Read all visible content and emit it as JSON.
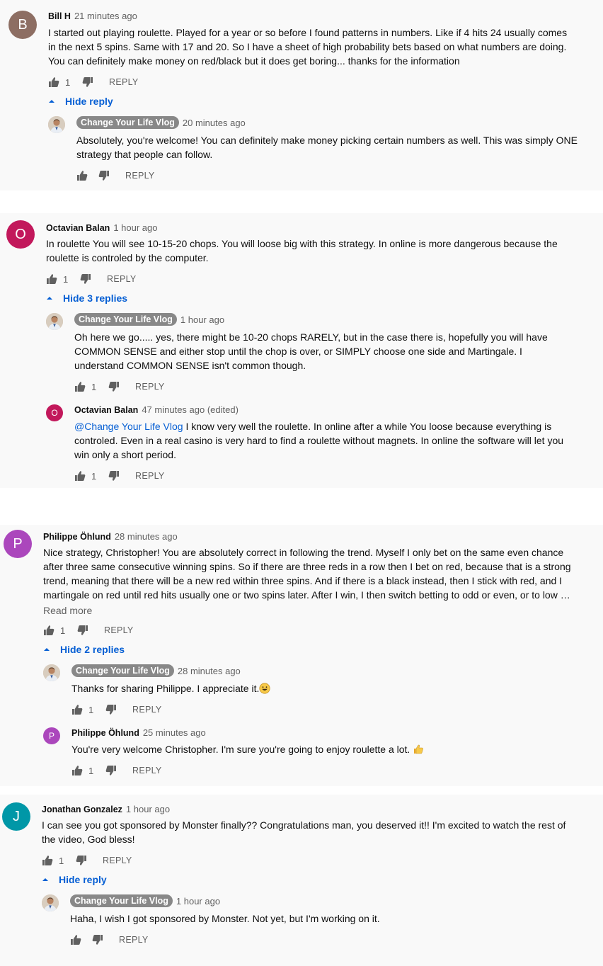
{
  "reply_label": "REPLY",
  "threads": [
    {
      "author": "Bill H",
      "initial": "B",
      "avatar_color": "#8d6e63",
      "time": "21 minutes ago",
      "text": "I started out playing roulette. Played for a year or so before I found patterns in numbers. Like if 4 hits 24 usually comes in the next 5 spins. Same with 17 and 20. So I have a sheet of high probability bets based on what numbers are doing. You can definitely make money on red/black but it does get boring... thanks for the information",
      "likes": "1",
      "toggle": "Hide reply",
      "replies": [
        {
          "author": "Change Your Life Vlog",
          "time": "20 minutes ago",
          "text": "Absolutely, you're welcome! You can definitely make money picking certain numbers as well. This was simply ONE strategy that people can follow.",
          "likes": ""
        }
      ]
    },
    {
      "author": "Octavian Balan",
      "initial": "O",
      "avatar_color": "#c2185b",
      "time": "1 hour ago",
      "text": "In roulette You will see 10-15-20 chops. You will loose big with this strategy. In online is more dangerous because  the roulette is controled by the computer.",
      "likes": "1",
      "toggle": "Hide 3 replies",
      "replies": [
        {
          "author": "Change Your Life Vlog",
          "time": "1 hour ago",
          "text": "Oh here we go..... yes, there might be 10-20 chops RARELY, but in the case there is, hopefully you will have COMMON SENSE and either stop until the chop is over, or SIMPLY choose one side and Martingale. I understand COMMON SENSE isn't common though.",
          "likes": "1"
        },
        {
          "author": "Octavian Balan",
          "initial": "O",
          "avatar_color": "#c2185b",
          "time": "47 minutes ago (edited)",
          "mention": "@Change Your Life Vlog",
          "text": "  I know very well the roulette. In online after a while You loose because everything is controled. Even in a real casino is very hard to find a roulette without magnets. In online the software will let you win only a short period.",
          "likes": "1"
        }
      ]
    },
    {
      "author": "Philippe Öhlund",
      "initial": "P",
      "avatar_color": "#ab47bc",
      "time": "28 minutes ago",
      "text": "Nice strategy, Christopher! You are absolutely correct in following the trend. Myself I only bet on the same even chance after three same consecutive winning spins. So if there are three reds in a row then I bet on red, because that is a strong trend, meaning that there will be a new red within three spins. And if there is a black instead, then I stick with red, and I martingale on red until red hits usually one or two spins later. After I win, I then switch betting to odd or even, or to low …",
      "read_more": "Read more",
      "likes": "1",
      "toggle": "Hide 2 replies",
      "replies": [
        {
          "author": "Change Your Life Vlog",
          "time": "28 minutes ago",
          "text": "Thanks for sharing Philippe. I appreciate it.",
          "emoji": "grinning-face",
          "likes": "1"
        },
        {
          "author": "Philippe Öhlund",
          "initial": "P",
          "avatar_color": "#ab47bc",
          "time": "25 minutes ago",
          "text": "You're very welcome Christopher. I'm sure you're going to enjoy roulette a lot.",
          "emoji": "thumbs-up",
          "likes": "1"
        }
      ]
    },
    {
      "author": "Jonathan Gonzalez",
      "initial": "J",
      "avatar_color": "#0097a7",
      "time": "1 hour ago",
      "text": "I can see you got sponsored by Monster finally?? Congratulations man, you deserved it!! I'm excited to watch the rest of the video, God bless!",
      "likes": "1",
      "toggle": "Hide reply",
      "replies": [
        {
          "author": "Change Your Life Vlog",
          "time": "1 hour ago",
          "text": "Haha, I wish I got sponsored by Monster. Not yet, but I'm working on it.",
          "likes": ""
        }
      ]
    }
  ]
}
